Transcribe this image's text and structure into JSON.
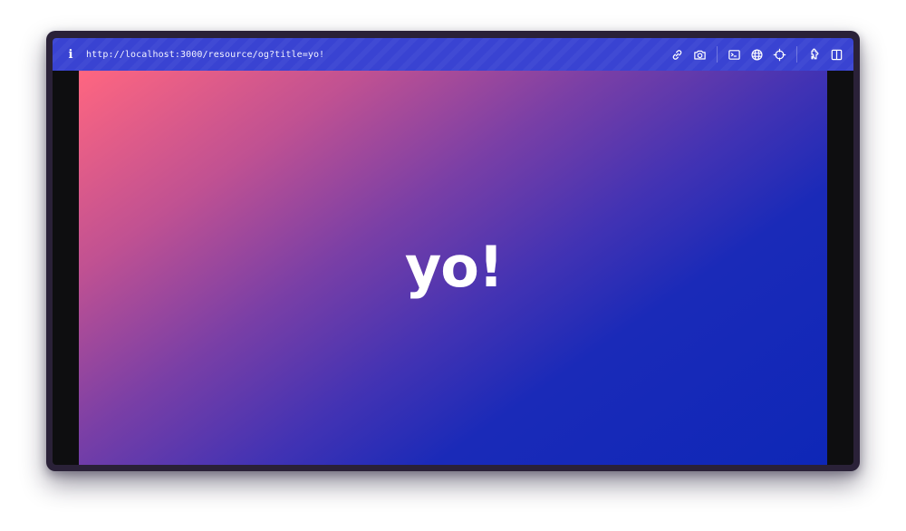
{
  "toolbar": {
    "info_label": "i",
    "url": "http://localhost:3000/resource/og?title=yo!",
    "icons": [
      "link-icon",
      "camera-icon",
      "terminal-icon",
      "globe-icon",
      "crosshair-icon",
      "puzzle-icon",
      "split-view-icon"
    ],
    "accent": "#3943d2"
  },
  "preview": {
    "title": "yo!",
    "gradient": [
      "#ff6680",
      "#7a3fa6",
      "#0e27b7"
    ]
  }
}
